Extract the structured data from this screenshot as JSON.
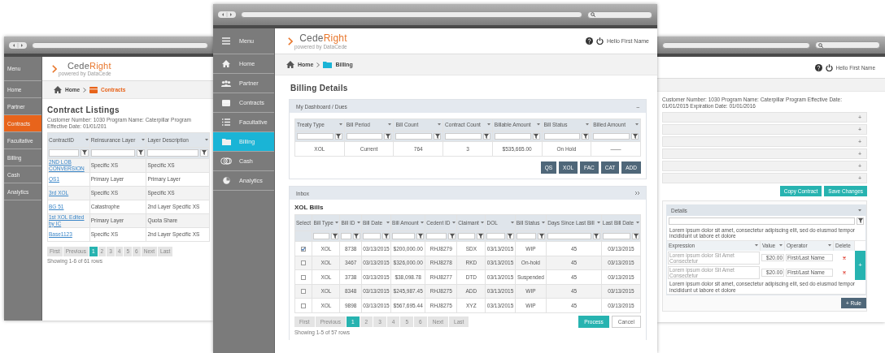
{
  "windows": [
    {
      "kind": "contracts",
      "sidebar": [
        {
          "label": "Menu",
          "selected": false
        },
        {
          "label": "Home",
          "selected": false
        },
        {
          "label": "Partner",
          "selected": false
        },
        {
          "label": "Contracts",
          "selected": true
        },
        {
          "label": "Facultative",
          "selected": false
        },
        {
          "label": "Billing",
          "selected": false
        },
        {
          "label": "Cash",
          "selected": false
        },
        {
          "label": "Analytics",
          "selected": false
        }
      ],
      "logo": {
        "words": [
          "Cede",
          "Right"
        ],
        "tagline": "powered by DataCede"
      },
      "breadcrumb": [
        "Home",
        "Contracts"
      ],
      "title": "Contract Listings",
      "info": "Customer Number: 1030   Program Name: Caterpillar Program   Effective Date: 01/01/201",
      "table": {
        "columns": [
          "ContractID",
          "Reinsurance Layer",
          "Layer Description"
        ],
        "rows": [
          [
            "2ND LOB CONVERSION",
            "Specific XS",
            "Specific XS"
          ],
          [
            "QS1",
            "Primary Layer",
            "Primary Layer"
          ],
          [
            "3rd XOL",
            "Specific XS",
            "Specific XS"
          ],
          [
            "BG 51",
            "Catastrophe",
            "2nd Layer Specific XS"
          ],
          [
            "1st XOL Edited by IC",
            "Primary Layer",
            "Quota Share"
          ],
          [
            "Base1123",
            "Specific XS",
            "2nd Layer Specific XS"
          ]
        ],
        "pagination": [
          {
            "label": "First",
            "selected": false
          },
          {
            "label": "Previous",
            "selected": false
          },
          {
            "label": "1",
            "selected": true
          },
          {
            "label": "2",
            "selected": false
          },
          {
            "label": "3",
            "selected": false
          },
          {
            "label": "4",
            "selected": false
          },
          {
            "label": "5",
            "selected": false
          },
          {
            "label": "6",
            "selected": false
          },
          {
            "label": "Next",
            "selected": false
          },
          {
            "label": "Last",
            "selected": false
          }
        ],
        "footer": "Showing 1-6 of 61 rows"
      }
    },
    {
      "kind": "billing",
      "sidebar": [
        {
          "label": "Menu",
          "selected": false
        },
        {
          "label": "Home",
          "selected": false
        },
        {
          "label": "Partner",
          "selected": false
        },
        {
          "label": "Contracts",
          "selected": false
        },
        {
          "label": "Facultative",
          "selected": false
        },
        {
          "label": "Billing",
          "selected": true
        },
        {
          "label": "Cash",
          "selected": false
        },
        {
          "label": "Analytics",
          "selected": false
        }
      ],
      "logo": {
        "words": [
          "Cede",
          "Right"
        ],
        "tagline": "powered by DataCede"
      },
      "user": "Hello First Name",
      "breadcrumb": [
        "Home",
        "Billing"
      ],
      "title": "Billing Details",
      "dashboard": {
        "title": "My Dashboard / Dues",
        "toggle": "–",
        "columns": [
          "Treaty Type",
          "Bill Period",
          "Bill Count",
          "Contract Count",
          "Billable Amount",
          "Bill Status",
          "Billed Amount"
        ],
        "rows": [
          [
            "XOL",
            "Current",
            "764",
            "3",
            "$535,665.00",
            "On Hold",
            "——"
          ]
        ],
        "buttons": [
          "QS",
          "XOL",
          "FAC",
          "CAT",
          "ADD"
        ]
      },
      "inbox": {
        "title": "Inbox",
        "subtitle": "XOL Bills",
        "select_column": "Select",
        "columns": [
          "Bill Type",
          "Bill ID",
          "Bill Date",
          "Bill Amount",
          "Cedent ID",
          "Claimant",
          "DOL",
          "Bill Status",
          "Days Since Last Bill",
          "Last Bill Date"
        ],
        "rows": [
          {
            "checked": true,
            "cells": [
              "XOL",
              "8738",
              "03/13/2015",
              "$200,000.00",
              "RHJ8279",
              "SDX",
              "03/13/2015",
              "WIP",
              "45",
              "03/13/2015"
            ]
          },
          {
            "checked": false,
            "cells": [
              "XOL",
              "3467",
              "03/13/2015",
              "$326,000.00",
              "RHJ8278",
              "RKD",
              "03/13/2015",
              "On-hold",
              "45",
              "03/13/2015"
            ]
          },
          {
            "checked": false,
            "cells": [
              "XOL",
              "3738",
              "03/13/2015",
              "$38,098.78",
              "RHJ8277",
              "DTD",
              "03/13/2015",
              "Suspended",
              "45",
              "03/13/2015"
            ]
          },
          {
            "checked": false,
            "cells": [
              "XOL",
              "8348",
              "03/13/2015",
              "$245,987.45",
              "RHJ8275",
              "ADD",
              "03/13/2015",
              "WIP",
              "45",
              "03/13/2015"
            ]
          },
          {
            "checked": false,
            "cells": [
              "XOL",
              "9898",
              "03/13/2015",
              "$567,695.44",
              "RHJ8275",
              "XYZ",
              "03/13/2015",
              "WIP",
              "45",
              "03/13/2015"
            ]
          }
        ],
        "pagination": [
          {
            "label": "First",
            "selected": false
          },
          {
            "label": "Previous",
            "selected": false
          },
          {
            "label": "1",
            "selected": true
          },
          {
            "label": "2",
            "selected": false
          },
          {
            "label": "3",
            "selected": false
          },
          {
            "label": "4",
            "selected": false
          },
          {
            "label": "5",
            "selected": false
          },
          {
            "label": "6",
            "selected": false
          },
          {
            "label": "Next",
            "selected": false
          },
          {
            "label": "Last",
            "selected": false
          }
        ],
        "actions": [
          "Process",
          "Cancel"
        ],
        "footer": "Showing 1-5 of 57 rows"
      }
    },
    {
      "kind": "detail",
      "user": "Hello First Name",
      "info": "Customer Number: 1030   Program Name: Caterpillar Program   Effective Date: 01/01/2015   Expiration Date: 01/01/2016",
      "sections": [
        "+",
        "+",
        "+",
        "+",
        "+",
        "+"
      ],
      "buttons": [
        "Copy Contract",
        "Save Changes"
      ],
      "rules": {
        "header": "Details",
        "note": "Lorem ipsum dolor sit amet, consectetur adipiscing elit, sed do eiusmod tempor incididunt ut labore et dolore",
        "columns": [
          "Expression",
          "Value",
          "Operator",
          "Delete"
        ],
        "rows": [
          {
            "expression": "Lorem ipsum dolor Sit Amet Consectetur",
            "value": "$20.00",
            "operator": "First/Last Name"
          },
          {
            "expression": "Lorem ipsum dolor Sit Amet Consectetur",
            "value": "$20.00",
            "operator": "First/Last Name"
          }
        ],
        "add": "+",
        "footer_note": "Lorem ipsum dolor sit amet, consectetur adipiscing elit, sed do eiusmod tempor incididunt ut labore et dolore",
        "button": "+ Rule"
      }
    }
  ]
}
